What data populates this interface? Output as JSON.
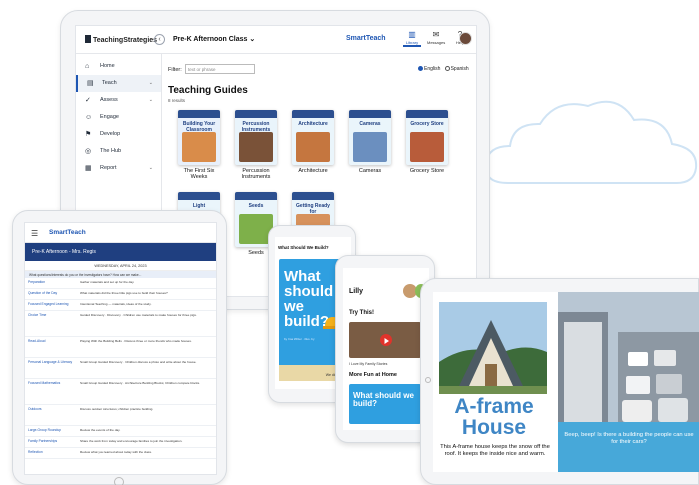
{
  "main_tablet": {
    "logo": "TeachingStrategies",
    "collapse_glyph": "‹",
    "class_selector": "Pre-K Afternoon Class",
    "class_chevron": "⌄",
    "brand": "SmartTeach",
    "top_icons": [
      {
        "label": "Library",
        "icon": "library-icon",
        "glyph": "▥",
        "active": true
      },
      {
        "label": "Messages",
        "icon": "messages-icon",
        "glyph": "✉",
        "active": false
      },
      {
        "label": "Help",
        "icon": "help-icon",
        "glyph": "?",
        "active": false
      }
    ],
    "nav": [
      {
        "label": "Home",
        "icon": "home-icon",
        "glyph": "⌂",
        "chevron": "",
        "active": false
      },
      {
        "label": "Teach",
        "icon": "teach-icon",
        "glyph": "▤",
        "chevron": "⌄",
        "active": true
      },
      {
        "label": "Assess",
        "icon": "assess-icon",
        "glyph": "✓",
        "chevron": "⌄",
        "active": false
      },
      {
        "label": "Engage",
        "icon": "engage-icon",
        "glyph": "☺",
        "chevron": "",
        "active": false
      },
      {
        "label": "Develop",
        "icon": "develop-icon",
        "glyph": "⚑",
        "chevron": "",
        "active": false
      },
      {
        "label": "The Hub",
        "icon": "hub-icon",
        "glyph": "◎",
        "chevron": "",
        "active": false
      },
      {
        "label": "Report",
        "icon": "report-icon",
        "glyph": "▦",
        "chevron": "⌄",
        "active": false
      }
    ],
    "filter_label": "Filter:",
    "filter_placeholder": "text or phrase",
    "language_english": "English",
    "language_spanish": "Spanish",
    "selected_language": "English",
    "guides_title": "Teaching Guides",
    "guides_count": "8 results",
    "guides": [
      {
        "caption": "The First Six Weeks",
        "cover_title": "Building Your Classroom Community",
        "color": "#e8f0fb",
        "pic": "#d98c4a"
      },
      {
        "caption": "Percussion Instruments",
        "cover_title": "Percussion Instruments",
        "color": "#e9f4fb",
        "pic": "#7a5238"
      },
      {
        "caption": "Architecture",
        "cover_title": "Architecture",
        "color": "#eaf5fb",
        "pic": "#c5763f"
      },
      {
        "caption": "Cameras",
        "cover_title": "Cameras",
        "color": "#eaf5fb",
        "pic": "#6b8fbf"
      },
      {
        "caption": "Grocery Store",
        "cover_title": "Grocery Store",
        "color": "#eaf5fb",
        "pic": "#b85c3a"
      },
      {
        "caption": "",
        "cover_title": "Light",
        "color": "#eaf5fb",
        "pic": "#5f8fd1"
      },
      {
        "caption": "Seeds",
        "cover_title": "Seeds",
        "color": "#eaf5fb",
        "pic": "#7eb04a"
      },
      {
        "caption": "",
        "cover_title": "Getting Ready for Kindergarten",
        "color": "#eaf5fb",
        "pic": "#d7925c"
      }
    ]
  },
  "left_tablet": {
    "menu_glyph": "☰",
    "brand": "SmartTeach",
    "class_band": "Pre-K Afternoon - Mrs. Regis",
    "date": "WEDNESDAY, APRIL 24, 2023",
    "question": "What questions/interests do you or the investigators have? How can we make...",
    "rows": [
      {
        "label": "Preparation",
        "text": "Gather materials and set up for the day."
      },
      {
        "label": "Question of the Day",
        "text": "What materials did the three little pigs use to build their houses?"
      },
      {
        "label": "Focused Engaged Learning",
        "text": "Intentional Teaching — materials, ideas of the study."
      },
      {
        "label": "Choice Time",
        "text": "Guided Discovery · Discovery · Children use materials to make houses for three pigs."
      },
      {
        "label": "Read-Aloud",
        "text": "Playing With the Building Bells · Discuss three or more friends who made houses."
      },
      {
        "label": "Personal Language & Literacy",
        "text": "Small Group Guided Discovery · Children discuss a photo and write about the house."
      },
      {
        "label": "Focused Mathematics",
        "text": "Small Group Guided Discovery · Architecture Building Blocks; Children compare blocks."
      },
      {
        "label": "Outdoors",
        "text": "Discuss outdoor structures; children practice building."
      },
      {
        "label": "Large-Group Roundup",
        "text": "Review the events of the day."
      },
      {
        "label": "Family Partnerships",
        "text": "Share the work from today and encourage families to join the investigation."
      },
      {
        "label": "Reflection",
        "text": "Review what you learned about today with the class."
      }
    ]
  },
  "phone_one": {
    "heading": "What Should We Build?",
    "card_title": "What should we build?",
    "byline": "by Ima Writer · illus. by",
    "footer": "We did this!"
  },
  "phone_two": {
    "child_name": "Lilly",
    "try_this": "Try This!",
    "video_caption": "I Love My Family Stories",
    "more_at_home": "More Fun at Home",
    "card_title": "What should we build?"
  },
  "right_tablet": {
    "page_title": "A-frame House",
    "page_text": "This A-frame house keeps the snow off the roof. It keeps the inside nice and warm.",
    "right_page_text": "Beep, beep! Is there a building the people can use for their cars?"
  },
  "colors": {
    "brand_blue": "#1e56b3",
    "dark_blue": "#1f3f80",
    "book_blue": "#2f9fe0",
    "title_blue": "#3f86c5"
  }
}
